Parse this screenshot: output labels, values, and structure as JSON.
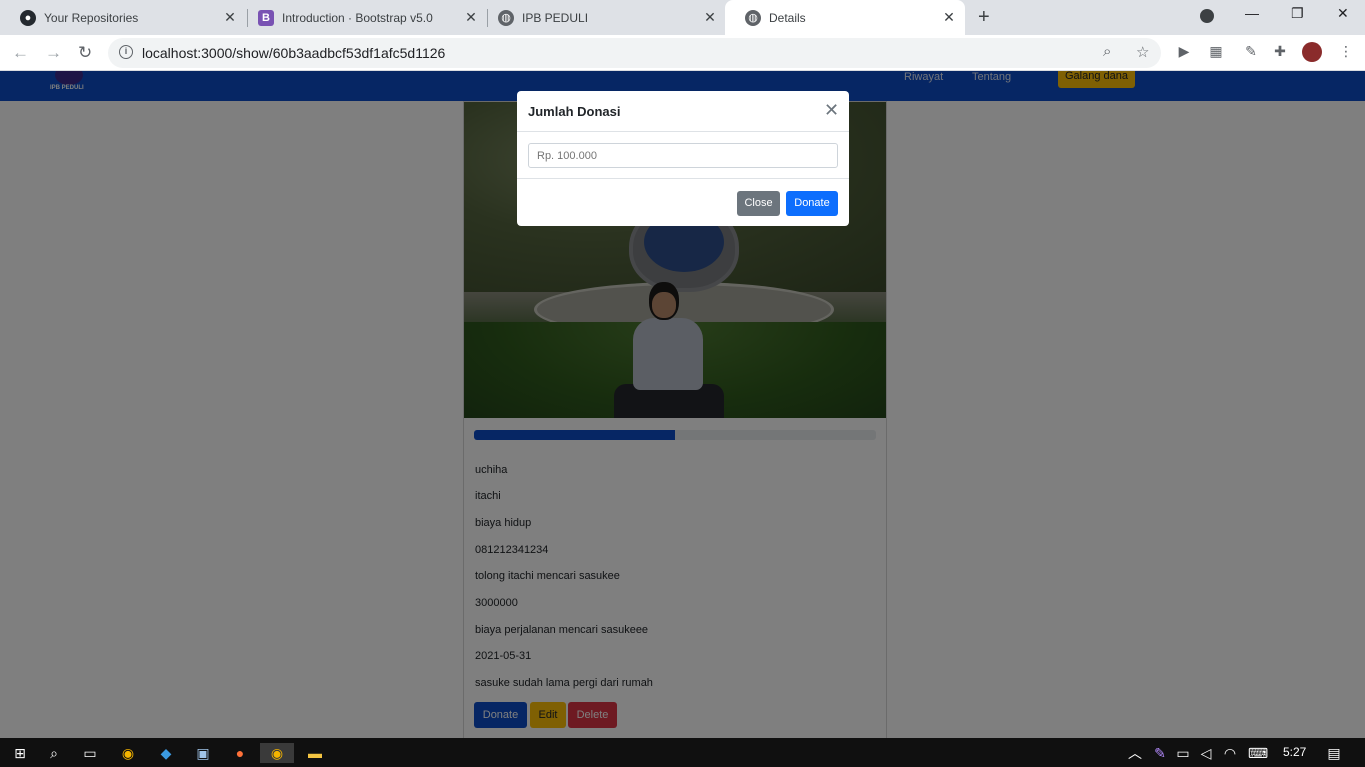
{
  "browser": {
    "tabs": [
      {
        "title": "Your Repositories",
        "icon": "github-icon"
      },
      {
        "title": "Introduction · Bootstrap v5.0",
        "icon": "bootstrap-icon"
      },
      {
        "title": "IPB PEDULI",
        "icon": "globe-icon"
      },
      {
        "title": "Details",
        "icon": "globe-icon"
      }
    ],
    "url": "localhost:3000/show/60b3aadbcf53df1afc5d1126"
  },
  "navbar": {
    "brand": "IPB PEDULI",
    "links": [
      "Riwayat",
      "Tentang"
    ],
    "cta": "Galang dana"
  },
  "campaign": {
    "progress_fraction": 0.5,
    "fields": [
      "uchiha",
      "itachi",
      "biaya hidup",
      "081212341234",
      "tolong itachi mencari sasukee",
      "3000000",
      "biaya perjalanan mencari sasukeee",
      "2021-05-31",
      "sasuke sudah lama pergi dari rumah"
    ],
    "buttons": {
      "donate": "Donate",
      "edit": "Edit",
      "delete": "Delete"
    }
  },
  "modal": {
    "title": "Jumlah Donasi",
    "input_placeholder": "Rp. 100.000",
    "close_label": "Close",
    "donate_label": "Donate"
  },
  "taskbar": {
    "time": "5:27"
  },
  "colors": {
    "primary": "#0d4dc9",
    "warning": "#ffc107",
    "danger": "#dc3545"
  }
}
